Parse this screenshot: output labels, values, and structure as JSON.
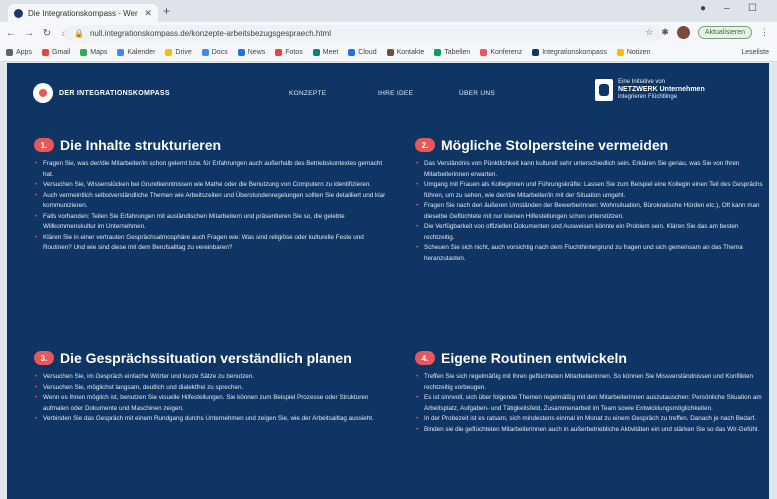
{
  "browser": {
    "tab_title": "Die Integrationskompass - Wer Ist",
    "url": "null.integrationskompass.de/konzepte-arbeitsbezugsgespraech.html",
    "update_label": "Aktualisieren",
    "bookmarks": [
      {
        "label": "Apps",
        "color": "#5f6368"
      },
      {
        "label": "Gmail",
        "color": "#ea4335"
      },
      {
        "label": "Maps",
        "color": "#34a853"
      },
      {
        "label": "Kalender",
        "color": "#4285f4"
      },
      {
        "label": "Drive",
        "color": "#fbbc05"
      },
      {
        "label": "Docs",
        "color": "#4285f4"
      },
      {
        "label": "News",
        "color": "#1a73e8"
      },
      {
        "label": "Fotos",
        "color": "#ea4335"
      },
      {
        "label": "Meet",
        "color": "#00897b"
      },
      {
        "label": "Cloud",
        "color": "#1a73e8"
      },
      {
        "label": "Kontakte",
        "color": "#6d4c41"
      },
      {
        "label": "Tabellen",
        "color": "#0f9d58"
      },
      {
        "label": "Konferenz",
        "color": "#e8585a"
      },
      {
        "label": "Integrationskompass",
        "color": "#0e3563"
      },
      {
        "label": "Notizen",
        "color": "#fbbc05"
      }
    ],
    "reading_list": "Leseliste"
  },
  "site": {
    "brand": "DER INTEGRATIONSKOMPASS",
    "nav": [
      "KONZEPTE",
      "IHRE IDEE",
      "ÜBER UNS"
    ],
    "partner": {
      "line1": "Eine Initiative von",
      "line2": "NETZWERK Unternehmen",
      "line3": "integrieren Flüchtlinge"
    }
  },
  "sections": [
    {
      "number": "1.",
      "title": "Die Inhalte strukturieren",
      "items": [
        "Fragen Sie, was der/die Mitarbeiter/in schon gelernt bzw. für Erfahrungen auch außerhalb des Betriebskontextes gemacht hat.",
        "Versuchen Sie, Wissenslücken bei Grundkenntnissen wie Mathe oder die Benutzung von Computern zu identifizieren.",
        "Auch vermeintlich selbstverständliche Themen wie Arbeitszeiten und Überstundenregelungen sollten Sie detailliert und klar kommunizieren.",
        "Falls vorhanden: Teilen Sie Erfahrungen mit ausländischen Mitarbeitern und präsentieren Sie so, die gelebte Willkommenskultur im Unternehmen.",
        "Klären Sie in einer vertrauten Gesprächsatmosphäre auch Fragen wie: Was sind religiöse oder kulturelle Feste und Routinen? Und wie sind diese mit dem Berufsalltag zu vereinbaren?"
      ]
    },
    {
      "number": "2.",
      "title": "Mögliche Stolpersteine vermeiden",
      "items": [
        "Das Verständnis von Pünktlichkeit kann kulturell sehr unterschiedlich sein. Erklären Sie genau, was Sie von Ihren Mitarbeiterinnen erwarten.",
        "Umgang mit Frauen als Kolleginnen und Führungskräfte: Lassen Sie zum Beispiel eine Kollegin einen Teil des Gesprächs führen, um zu sehen, wie der/die Mitarbeiter/in mit der Situation umgeht.",
        "Fragen Sie nach den äußeren Umständen der Bewerberinnen: Wohnsituation, Bürokratische Hürden etc.), Oft kann man dieselbe Geflüchtete mit nur kleinen Hilfestellungen schon unterstützen.",
        "Die Verfügbarkeit von offiziellen Dokumenten und Ausweisen könnte ein Problem sein. Klären Sie das am besten rechtzeitig.",
        "Scheuen Sie sich nicht, auch vorsichtig nach dem Fluchthintergrund zu fragen und sich gemeinsam an das Thema heranzutasten."
      ]
    },
    {
      "number": "3.",
      "title": "Die Gesprächssituation verständlich planen",
      "items": [
        "Versuchen Sie, im Gespräch einfache Wörter und kurze Sätze zu benutzen.",
        "Versuchen Sie, möglichst langsam, deutlich und dialektfrei zu sprechen.",
        "Wenn es Ihnen möglich ist, benutzen Sie visuelle Hilfestellungen. Sie können zum Beispiel Prozesse oder Strukturen aufmalen oder Dokumente und Maschinen zeigen.",
        "Verbinden Sie das Gespräch mit einem Rundgang durchs Unternehmen und zeigen Sie, wie der Arbeitsalltag aussieht."
      ]
    },
    {
      "number": "4.",
      "title": "Eigene Routinen entwickeln",
      "items": [
        "Treffen Sie sich regelmäßig mit Ihren geflüchteten Mitarbeiterinnen. So können Sie Missverständnissen und Konflikten rechtzeitig vorbeugen.",
        "Es ist sinnvoll, sich über folgende Themen regelmäßig mit den Mitarbeiterinnen auszutauschen: Persönliche Situation am Arbeitsplatz, Aufgaben- und Tätigkeitsfeld, Zusammenarbeit im Team sowie Entwicklungsmöglichkeiten.",
        "In der Probezeit ist es ratsam, sich mindestens einmal im Monat zu einem Gespräch zu treffen. Danach je nach Bedarf.",
        "Binden sie die geflüchteten Mitarbeiterinnen auch in außerbetriebliche Aktivitäten ein und stärken Sie so das Wir-Gefühl."
      ]
    }
  ]
}
